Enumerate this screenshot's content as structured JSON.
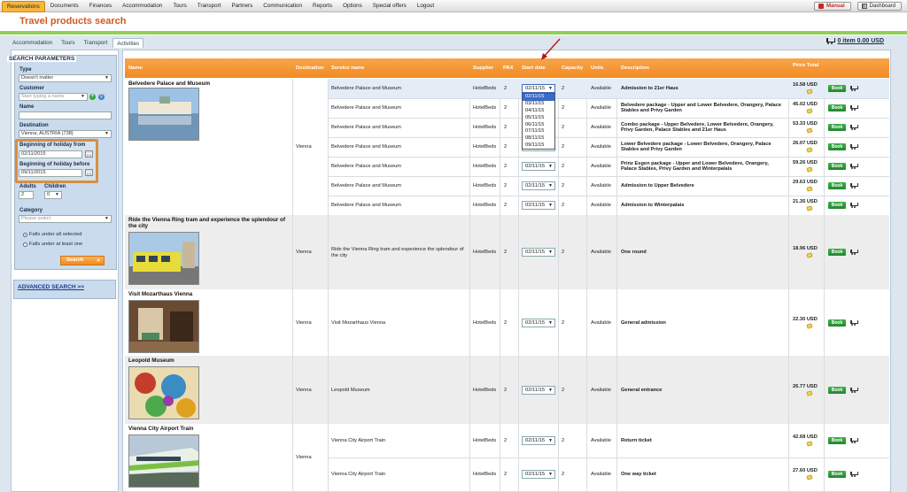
{
  "nav": {
    "items": [
      "Reservations",
      "Documents",
      "Finances",
      "Accommodation",
      "Tours",
      "Transport",
      "Partners",
      "Communication",
      "Reports",
      "Options",
      "Special offers",
      "Logout"
    ],
    "manual": "Manual",
    "dashboard": "Dashboard"
  },
  "page": {
    "title": "Travel products search",
    "tabs": [
      "Accommodation",
      "Tours",
      "Transport",
      "Activities"
    ],
    "active_tab": "Activities",
    "cart_summary": "0 item 0.00 USD"
  },
  "search": {
    "title": "SEARCH PARAMETERS",
    "type_label": "Type",
    "type_value": "Doesn't matter",
    "customer_label": "Customer",
    "customer_placeholder": "Start typing a name",
    "add_customer": "+",
    "search_customer": "Q",
    "name_label": "Name",
    "name_value": "",
    "destination_label": "Destination",
    "destination_value": "Vienna, AUSTRIA (738)",
    "from_label": "Beginning of holiday from",
    "from_value": "02/11/2015",
    "before_label": "Beginning of holiday before",
    "before_value": "09/11/2015",
    "adults_label": "Adults",
    "adults_value": "2",
    "children_label": "Children",
    "children_value": "0",
    "category_label": "Category",
    "category_placeholder": "Please select",
    "radio_all": "Falls under all selected",
    "radio_one": "Falls under at least one",
    "search_button": "Search",
    "advanced": "ADVANCED SEARCH >>"
  },
  "table": {
    "headers": {
      "name": "Name",
      "destination": "Destination",
      "service": "Service name",
      "supplier": "Supplier",
      "pax": "PAX",
      "start": "Start date",
      "capacity": "Capacity",
      "units": "Units",
      "description": "Description",
      "price": "Price Total"
    },
    "book_label": "Book",
    "open_dropdown_options": [
      "02/11/15",
      "03/11/15",
      "04/11/15",
      "05/11/15",
      "06/11/15",
      "07/11/15",
      "08/11/15",
      "09/11/15"
    ],
    "groups": [
      {
        "name": "Belvedere Palace and Museum",
        "destination": "Vienna",
        "rows": [
          {
            "service": "Belvedere Palace and Museum",
            "supplier": "HotelBeds",
            "pax": "2",
            "date": "02/11/15",
            "capacity": "2",
            "units": "Available",
            "description": "Admission to 21er Haus",
            "price": "16.58 USD"
          },
          {
            "service": "Belvedere Palace and Museum",
            "supplier": "HotelBeds",
            "pax": "2",
            "date": "02/11/15",
            "capacity": "2",
            "units": "Available",
            "description": "Belvedere package - Upper and Lower Belvedere, Orangery, Palace Stables and Privy Garden",
            "price": "45.02 USD"
          },
          {
            "service": "Belvedere Palace and Museum",
            "supplier": "HotelBeds",
            "pax": "2",
            "date": "02/11/15",
            "capacity": "2",
            "units": "Available",
            "description": "Combo package - Upper Belvedere, Lower Belvedere, Orangery, Privy Garden, Palace Stables and 21er Haus",
            "price": "53.33 USD"
          },
          {
            "service": "Belvedere Palace and Museum",
            "supplier": "HotelBeds",
            "pax": "2",
            "date": "02/11/15",
            "capacity": "2",
            "units": "Available",
            "description": "Lower Belvedere package - Lower Belvedere, Orangery, Palace Stables and Privy Garden",
            "price": "26.07 USD"
          },
          {
            "service": "Belvedere Palace and Museum",
            "supplier": "HotelBeds",
            "pax": "2",
            "date": "02/11/15",
            "capacity": "2",
            "units": "Available",
            "description": "Prinz Esgen package - Upper and Lower Belvedere, Orangery, Palace Stables, Privy Garden and Winterpalais",
            "price": "59.26 USD"
          },
          {
            "service": "Belvedere Palace and Museum",
            "supplier": "HotelBeds",
            "pax": "2",
            "date": "02/11/15",
            "capacity": "2",
            "units": "Available",
            "description": "Admission to Upper Belvedere",
            "price": "29.63 USD"
          },
          {
            "service": "Belvedere Palace and Museum",
            "supplier": "HotelBeds",
            "pax": "2",
            "date": "02/11/15",
            "capacity": "2",
            "units": "Available",
            "description": "Admission to Winterpalais",
            "price": "21.35 USD"
          }
        ]
      },
      {
        "name": "Ride the Vienna Ring tram and experience the splendour of the city",
        "destination": "Vienna",
        "rows": [
          {
            "service": "Ride the Vienna Ring tram and experience the splendour of the city",
            "supplier": "HotelBeds",
            "pax": "2",
            "date": "02/11/15",
            "capacity": "2",
            "units": "Available",
            "description": "One round",
            "price": "18.96 USD"
          }
        ]
      },
      {
        "name": "Visit Mozarthaus Vienna",
        "destination": "Vienna",
        "rows": [
          {
            "service": "Visit Mozarthaus Vienna",
            "supplier": "HotelBeds",
            "pax": "2",
            "date": "02/11/15",
            "capacity": "2",
            "units": "Available",
            "description": "General admission",
            "price": "22.30 USD"
          }
        ]
      },
      {
        "name": "Leopold Museum",
        "destination": "Vienna",
        "rows": [
          {
            "service": "Leopold Museum",
            "supplier": "HotelBeds",
            "pax": "2",
            "date": "02/11/15",
            "capacity": "2",
            "units": "Available",
            "description": "General entrance",
            "price": "26.77 USD"
          }
        ]
      },
      {
        "name": "Vienna City Airport Train",
        "destination": "Vienna",
        "rows": [
          {
            "service": "Vienna City Airport Train",
            "supplier": "HotelBeds",
            "pax": "2",
            "date": "02/11/15",
            "capacity": "2",
            "units": "Available",
            "description": "Return ticket",
            "price": "42.68 USD"
          },
          {
            "service": "Vienna City Airport Train",
            "supplier": "HotelBeds",
            "pax": "2",
            "date": "02/11/15",
            "capacity": "2",
            "units": "Available",
            "description": "One way ticket",
            "price": "27.60 USD"
          }
        ]
      }
    ]
  }
}
